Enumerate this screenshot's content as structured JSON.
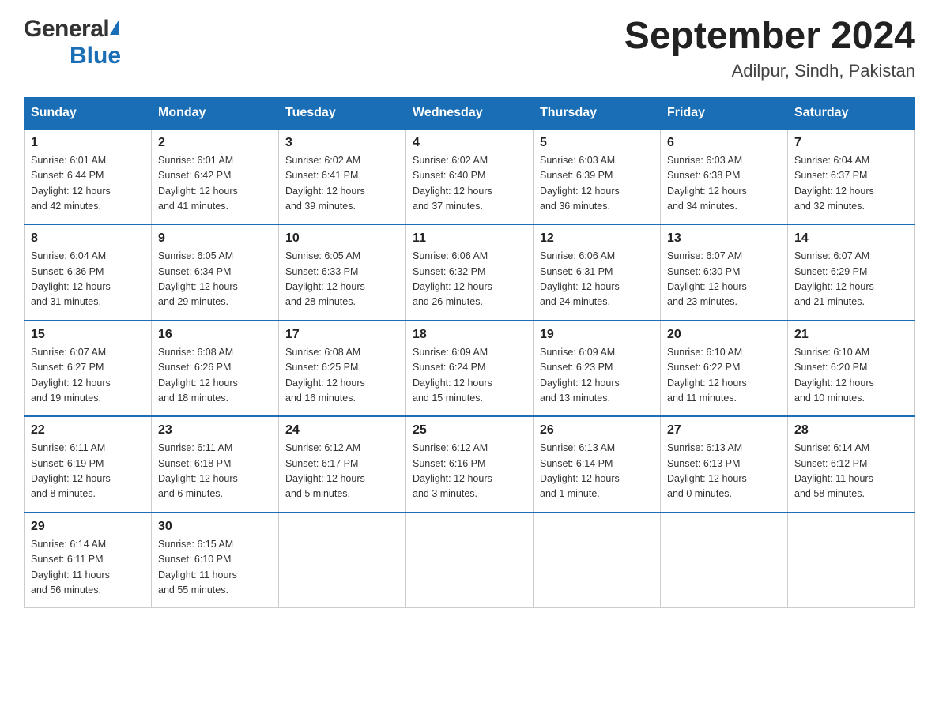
{
  "header": {
    "logo_general": "General",
    "logo_blue": "Blue",
    "month_year": "September 2024",
    "location": "Adilpur, Sindh, Pakistan"
  },
  "days_of_week": [
    "Sunday",
    "Monday",
    "Tuesday",
    "Wednesday",
    "Thursday",
    "Friday",
    "Saturday"
  ],
  "weeks": [
    [
      {
        "day": "1",
        "sunrise": "6:01 AM",
        "sunset": "6:44 PM",
        "daylight": "12 hours and 42 minutes."
      },
      {
        "day": "2",
        "sunrise": "6:01 AM",
        "sunset": "6:42 PM",
        "daylight": "12 hours and 41 minutes."
      },
      {
        "day": "3",
        "sunrise": "6:02 AM",
        "sunset": "6:41 PM",
        "daylight": "12 hours and 39 minutes."
      },
      {
        "day": "4",
        "sunrise": "6:02 AM",
        "sunset": "6:40 PM",
        "daylight": "12 hours and 37 minutes."
      },
      {
        "day": "5",
        "sunrise": "6:03 AM",
        "sunset": "6:39 PM",
        "daylight": "12 hours and 36 minutes."
      },
      {
        "day": "6",
        "sunrise": "6:03 AM",
        "sunset": "6:38 PM",
        "daylight": "12 hours and 34 minutes."
      },
      {
        "day": "7",
        "sunrise": "6:04 AM",
        "sunset": "6:37 PM",
        "daylight": "12 hours and 32 minutes."
      }
    ],
    [
      {
        "day": "8",
        "sunrise": "6:04 AM",
        "sunset": "6:36 PM",
        "daylight": "12 hours and 31 minutes."
      },
      {
        "day": "9",
        "sunrise": "6:05 AM",
        "sunset": "6:34 PM",
        "daylight": "12 hours and 29 minutes."
      },
      {
        "day": "10",
        "sunrise": "6:05 AM",
        "sunset": "6:33 PM",
        "daylight": "12 hours and 28 minutes."
      },
      {
        "day": "11",
        "sunrise": "6:06 AM",
        "sunset": "6:32 PM",
        "daylight": "12 hours and 26 minutes."
      },
      {
        "day": "12",
        "sunrise": "6:06 AM",
        "sunset": "6:31 PM",
        "daylight": "12 hours and 24 minutes."
      },
      {
        "day": "13",
        "sunrise": "6:07 AM",
        "sunset": "6:30 PM",
        "daylight": "12 hours and 23 minutes."
      },
      {
        "day": "14",
        "sunrise": "6:07 AM",
        "sunset": "6:29 PM",
        "daylight": "12 hours and 21 minutes."
      }
    ],
    [
      {
        "day": "15",
        "sunrise": "6:07 AM",
        "sunset": "6:27 PM",
        "daylight": "12 hours and 19 minutes."
      },
      {
        "day": "16",
        "sunrise": "6:08 AM",
        "sunset": "6:26 PM",
        "daylight": "12 hours and 18 minutes."
      },
      {
        "day": "17",
        "sunrise": "6:08 AM",
        "sunset": "6:25 PM",
        "daylight": "12 hours and 16 minutes."
      },
      {
        "day": "18",
        "sunrise": "6:09 AM",
        "sunset": "6:24 PM",
        "daylight": "12 hours and 15 minutes."
      },
      {
        "day": "19",
        "sunrise": "6:09 AM",
        "sunset": "6:23 PM",
        "daylight": "12 hours and 13 minutes."
      },
      {
        "day": "20",
        "sunrise": "6:10 AM",
        "sunset": "6:22 PM",
        "daylight": "12 hours and 11 minutes."
      },
      {
        "day": "21",
        "sunrise": "6:10 AM",
        "sunset": "6:20 PM",
        "daylight": "12 hours and 10 minutes."
      }
    ],
    [
      {
        "day": "22",
        "sunrise": "6:11 AM",
        "sunset": "6:19 PM",
        "daylight": "12 hours and 8 minutes."
      },
      {
        "day": "23",
        "sunrise": "6:11 AM",
        "sunset": "6:18 PM",
        "daylight": "12 hours and 6 minutes."
      },
      {
        "day": "24",
        "sunrise": "6:12 AM",
        "sunset": "6:17 PM",
        "daylight": "12 hours and 5 minutes."
      },
      {
        "day": "25",
        "sunrise": "6:12 AM",
        "sunset": "6:16 PM",
        "daylight": "12 hours and 3 minutes."
      },
      {
        "day": "26",
        "sunrise": "6:13 AM",
        "sunset": "6:14 PM",
        "daylight": "12 hours and 1 minute."
      },
      {
        "day": "27",
        "sunrise": "6:13 AM",
        "sunset": "6:13 PM",
        "daylight": "12 hours and 0 minutes."
      },
      {
        "day": "28",
        "sunrise": "6:14 AM",
        "sunset": "6:12 PM",
        "daylight": "11 hours and 58 minutes."
      }
    ],
    [
      {
        "day": "29",
        "sunrise": "6:14 AM",
        "sunset": "6:11 PM",
        "daylight": "11 hours and 56 minutes."
      },
      {
        "day": "30",
        "sunrise": "6:15 AM",
        "sunset": "6:10 PM",
        "daylight": "11 hours and 55 minutes."
      },
      null,
      null,
      null,
      null,
      null
    ]
  ],
  "labels": {
    "sunrise": "Sunrise:",
    "sunset": "Sunset:",
    "daylight": "Daylight:"
  }
}
